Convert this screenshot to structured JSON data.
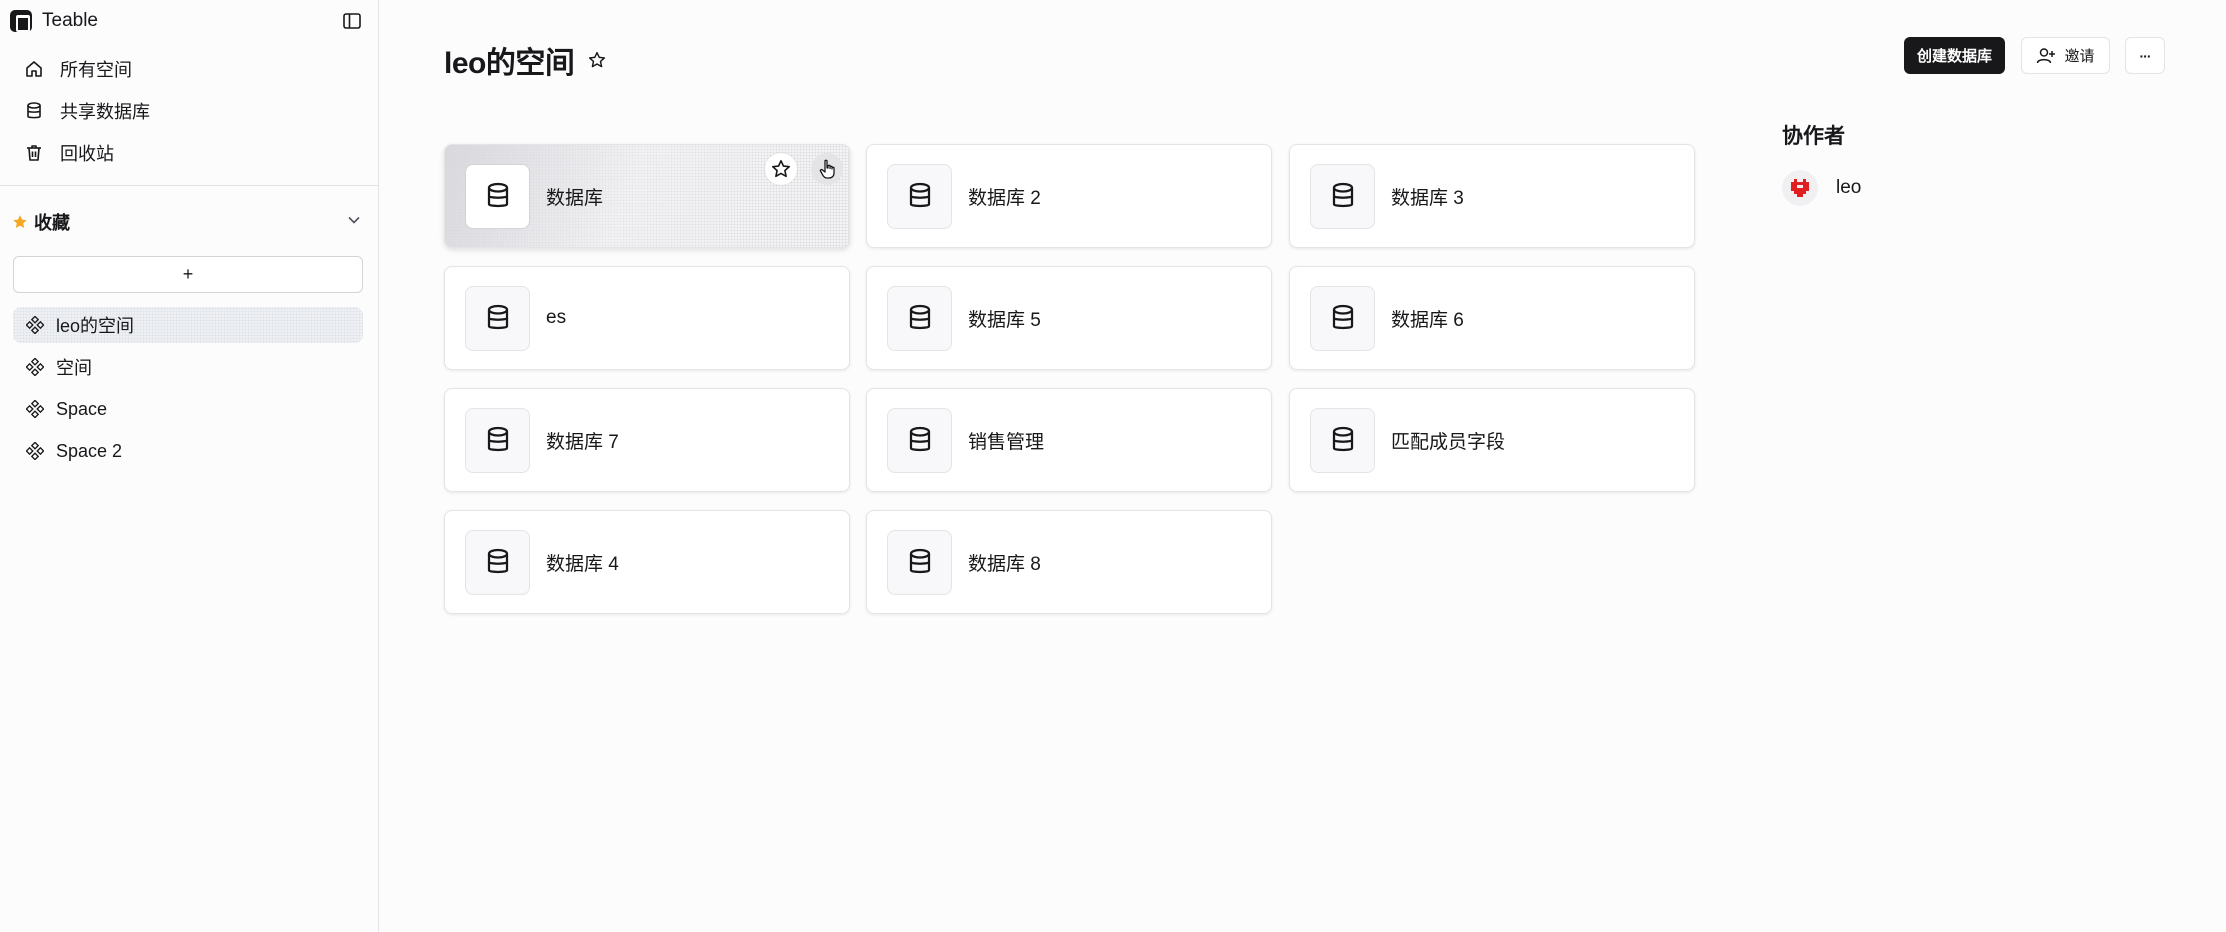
{
  "brand": {
    "name": "Teable"
  },
  "sidebar": {
    "nav": [
      {
        "label": "所有空间",
        "icon": "home-icon"
      },
      {
        "label": "共享数据库",
        "icon": "database-icon"
      },
      {
        "label": "回收站",
        "icon": "trash-icon"
      }
    ],
    "favorites": {
      "label": "收藏",
      "add_label": "+"
    },
    "spaces": [
      {
        "label": "leo的空间",
        "active": true
      },
      {
        "label": "空间",
        "active": false
      },
      {
        "label": "Space",
        "active": false
      },
      {
        "label": "Space 2",
        "active": false
      }
    ]
  },
  "header": {
    "title": "leo的空间",
    "create_label": "创建数据库",
    "invite_label": "邀请",
    "more_label": "···"
  },
  "bases": [
    {
      "name": "数据库"
    },
    {
      "name": "数据库 2"
    },
    {
      "name": "数据库 3"
    },
    {
      "name": "es"
    },
    {
      "name": "数据库 5"
    },
    {
      "name": "数据库 6"
    },
    {
      "name": "数据库 7"
    },
    {
      "name": "销售管理"
    },
    {
      "name": "匹配成员字段"
    },
    {
      "name": "数据库 4"
    },
    {
      "name": "数据库 8"
    }
  ],
  "collaborators": {
    "title": "协作者",
    "members": [
      {
        "name": "leo"
      }
    ]
  },
  "colors": {
    "accent": "#18181b",
    "favorite_star": "#f5a623",
    "avatar": "#e02020"
  }
}
